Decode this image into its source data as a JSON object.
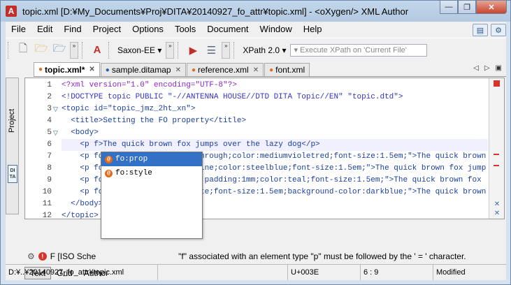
{
  "window": {
    "title": "topic.xml [D:¥My_Documents¥Proj¥DITA¥20140927_fo_attr¥topic.xml] - <oXygen/> XML Author",
    "app_icon": "A",
    "controls": {
      "minimize": "—",
      "maximize": "❐",
      "close": "✕"
    }
  },
  "menu": [
    "File",
    "Edit",
    "Find",
    "Project",
    "Options",
    "Tools",
    "Document",
    "Window",
    "Help"
  ],
  "toolbar": {
    "scenario": "Saxon-EE",
    "xpath_version": "XPath 2.0",
    "xpath_placeholder": "Execute XPath on 'Current File'"
  },
  "tabs": [
    {
      "label": "topic.xml*",
      "active": true,
      "dot_color": "#e06b1a"
    },
    {
      "label": "sample.ditamap",
      "active": false,
      "dot_color": "#2a5fb0"
    },
    {
      "label": "reference.xml",
      "active": false,
      "dot_color": "#e06b1a"
    },
    {
      "label": "font.xml",
      "active": false,
      "dot_color": "#e06b1a"
    }
  ],
  "sidebar": {
    "project_label": "Project",
    "dita_label_1": "DI",
    "dita_label_2": "TA"
  },
  "editor": {
    "line_numbers": [
      "1",
      "2",
      "3",
      "4",
      "5",
      "6",
      "7",
      "8",
      "9",
      "10",
      "11",
      "12"
    ],
    "lines": [
      "<?xml version=\"1.0\" encoding=\"UTF-8\"?>",
      "<!DOCTYPE topic PUBLIC \"-//ANTENNA HOUSE//DTD DITA Topic//EN\" \"topic.dtd\">",
      "<topic id=\"topic_jmz_2ht_xn\">",
      "  <title>Setting the FO property</title>",
      "  <body>",
      "    <p f>The quick brown fox jumps over the lazy dog</p>",
      "    <p fo            on:line-through;color:mediumvioletred;font-size:1.5em;\">The quick brown",
      "    <p fo            on:underline;color:steelblue;font-size:1.5em;\">The quick brown fox jump",
      "    <p fo            lid black;padding:1mm;color:teal;font-size:1.5em;\">The quick brown fox",
      "    <p fo            color:white;font-size:1.5em;background-color:darkblue;\">The quick brown",
      "  </body>",
      "</topic>"
    ]
  },
  "autocomplete": {
    "items": [
      {
        "label": "fo:prop",
        "selected": true
      },
      {
        "label": "fo:style",
        "selected": false
      }
    ]
  },
  "message": {
    "prefix": "F [ISO Sche",
    "text": "\"f\" associated with an element type \"p\" must be followed by the ' = ' character."
  },
  "modes": [
    {
      "label": "Text",
      "active": true
    },
    {
      "label": "Grid",
      "active": false
    },
    {
      "label": "Author",
      "active": false
    }
  ],
  "status": {
    "path": "D:¥..¥20140927_fo_attr¥topic.xml",
    "unicode": "U+003E",
    "position": "6 : 9",
    "state": "Modified"
  }
}
